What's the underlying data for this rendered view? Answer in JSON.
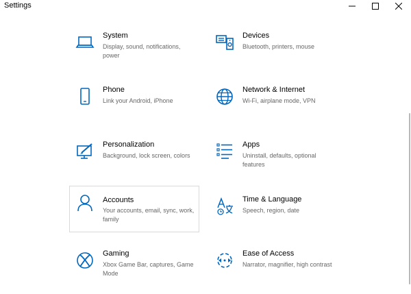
{
  "window": {
    "title": "Settings",
    "controls": {
      "minimize": "minimize-icon",
      "maximize": "maximize-icon",
      "close": "close-icon"
    }
  },
  "accent_color": "#0067c0",
  "categories": [
    {
      "name": "System",
      "description": "Display, sound, notifications, power",
      "icon": "laptop-icon"
    },
    {
      "name": "Devices",
      "description": "Bluetooth, printers, mouse",
      "icon": "keyboard-speaker-icon"
    },
    {
      "name": "Phone",
      "description": "Link your Android, iPhone",
      "icon": "phone-icon"
    },
    {
      "name": "Network & Internet",
      "description": "Wi-Fi, airplane mode, VPN",
      "icon": "globe-icon"
    },
    {
      "name": "Personalization",
      "description": "Background, lock screen, colors",
      "icon": "paint-brush-monitor-icon"
    },
    {
      "name": "Apps",
      "description": "Uninstall, defaults, optional features",
      "icon": "apps-list-icon"
    },
    {
      "name": "Accounts",
      "description": "Your accounts, email, sync, work, family",
      "icon": "person-icon"
    },
    {
      "name": "Time & Language",
      "description": "Speech, region, date",
      "icon": "time-language-icon"
    },
    {
      "name": "Gaming",
      "description": "Xbox Game Bar, captures, Game Mode",
      "icon": "xbox-icon"
    },
    {
      "name": "Ease of Access",
      "description": "Narrator, magnifier, high contrast",
      "icon": "ease-of-access-icon"
    }
  ]
}
